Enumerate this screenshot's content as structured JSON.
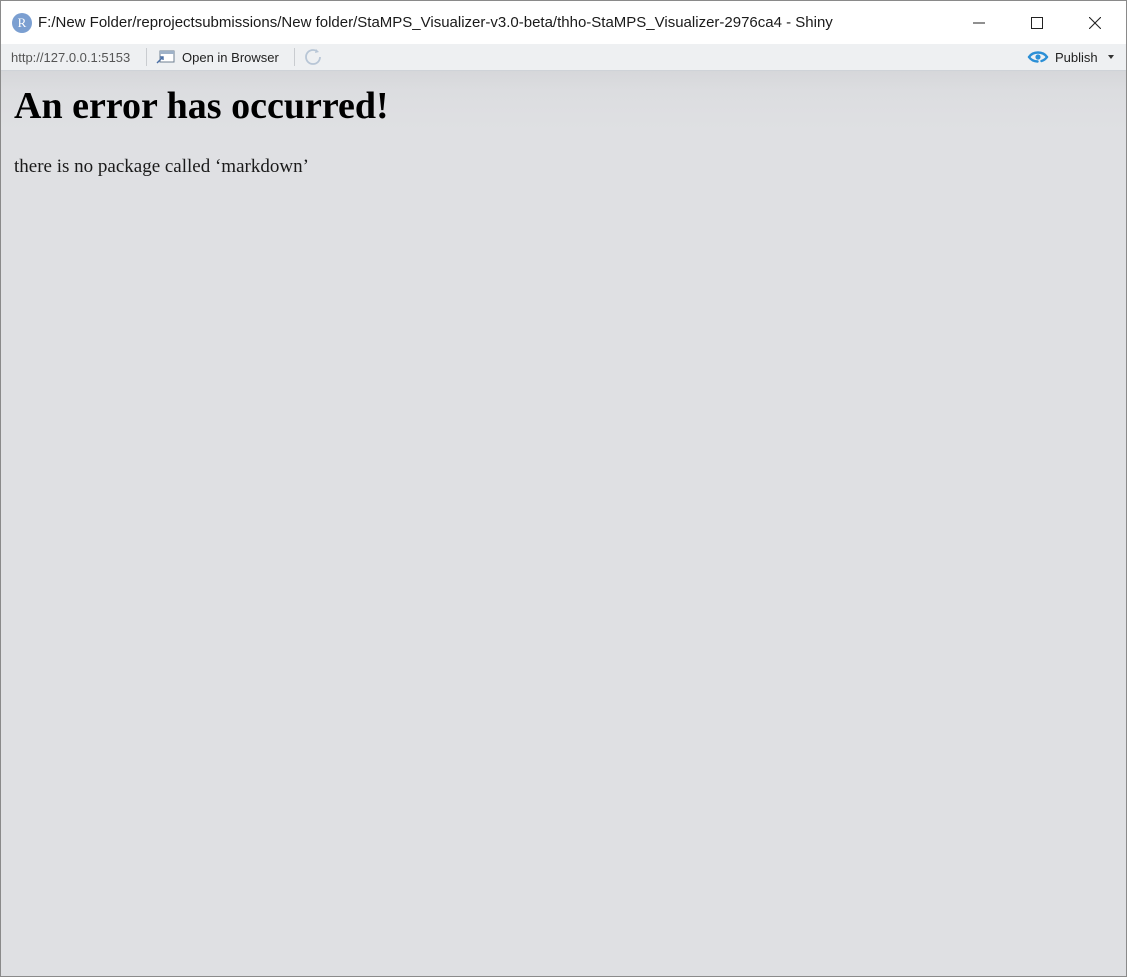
{
  "window": {
    "title": "F:/New Folder/reprojectsubmissions/New folder/StaMPS_Visualizer-v3.0-beta/thho-StaMPS_Visualizer-2976ca4 - Shiny",
    "app_icon_letter": "R"
  },
  "toolbar": {
    "url": "http://127.0.0.1:5153",
    "open_in_browser_label": "Open in Browser",
    "publish_label": "Publish"
  },
  "content": {
    "heading": "An error has occurred!",
    "message": "there is no package called ‘markdown’"
  },
  "colors": {
    "publish_accent": "#2b8fd6",
    "app_icon": "#7b9fd1",
    "content_bg": "#dfe0e3"
  }
}
